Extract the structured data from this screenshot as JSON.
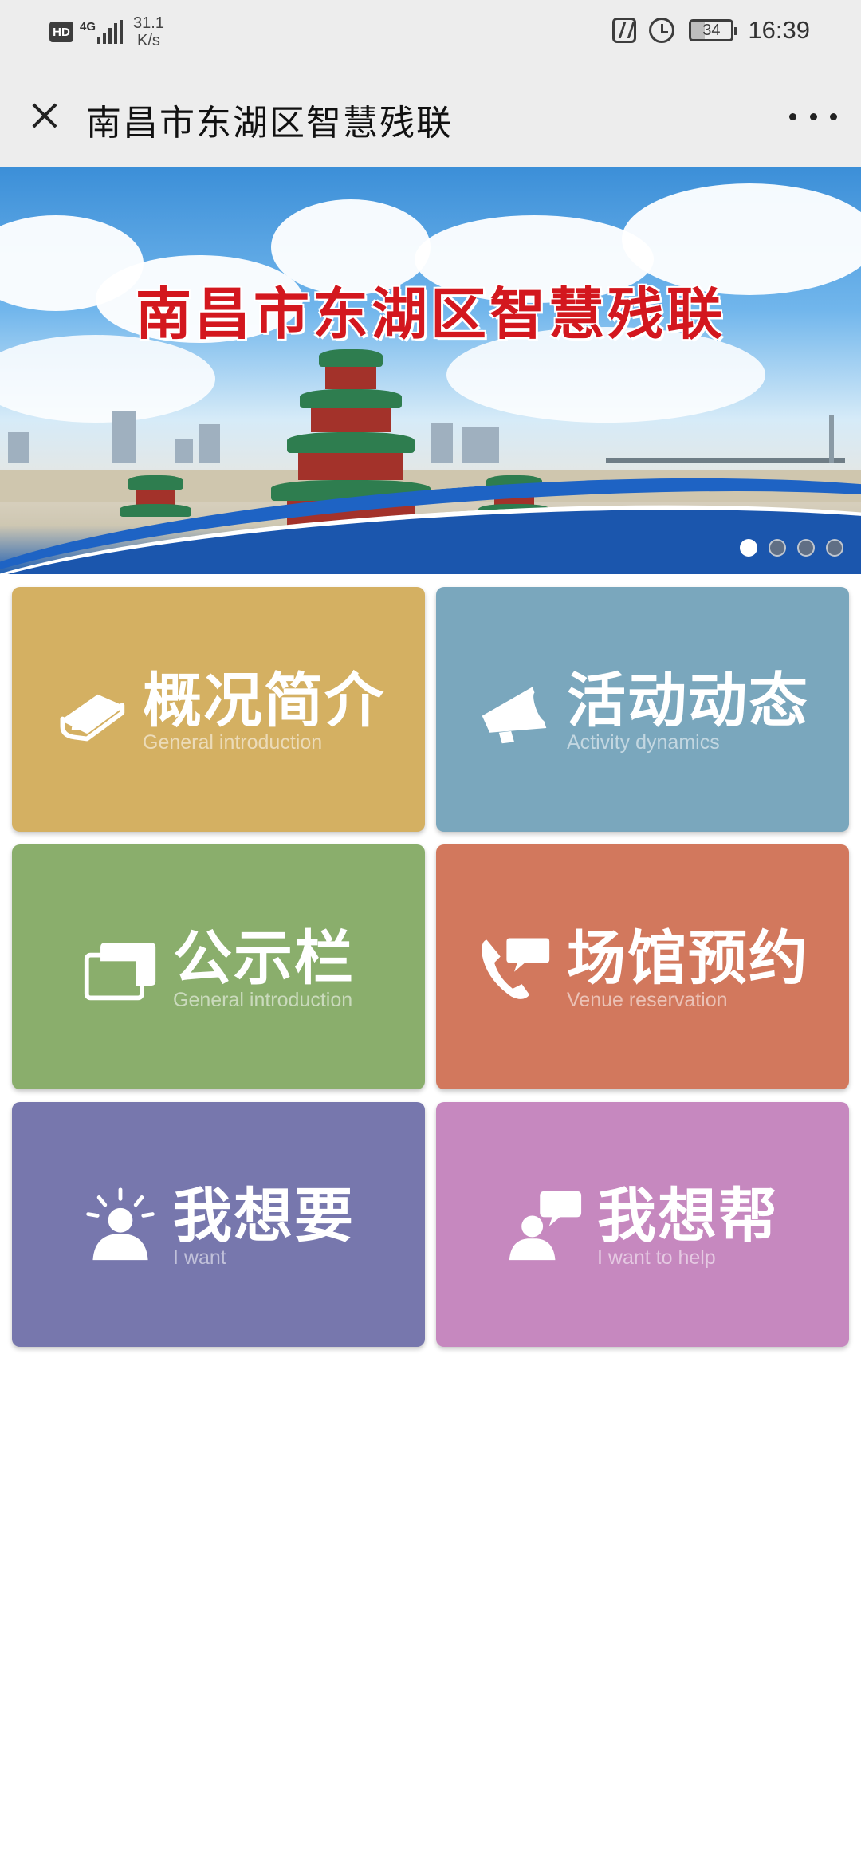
{
  "status_bar": {
    "hd_badge": "HD",
    "network_type": "4G",
    "speed_value": "31.1",
    "speed_unit": "K/s",
    "battery_level": "34",
    "time": "16:39"
  },
  "title_bar": {
    "title": "南昌市东湖区智慧残联",
    "close_icon": "close-icon",
    "more_icon": "more-dots-icon"
  },
  "banner": {
    "title": "南昌市东湖区智慧残联",
    "slide_count": 4,
    "active_slide": 1
  },
  "tiles": [
    {
      "title": "概况简介",
      "subtitle": "General introduction",
      "icon": "book-icon",
      "color": "#d4b062"
    },
    {
      "title": "活动动态",
      "subtitle": "Activity dynamics",
      "icon": "megaphone-icon",
      "color": "#7aa7bd"
    },
    {
      "title": "公示栏",
      "subtitle": "General introduction",
      "icon": "gallery-icon",
      "color": "#8aae6c"
    },
    {
      "title": "场馆预约",
      "subtitle": "Venue reservation",
      "icon": "phone-chat-icon",
      "color": "#d2785d"
    },
    {
      "title": "我想要",
      "subtitle": "I want",
      "icon": "idea-person-icon",
      "color": "#7777ad"
    },
    {
      "title": "我想帮",
      "subtitle": "I want to help",
      "icon": "helper-chat-icon",
      "color": "#c688bf"
    }
  ]
}
